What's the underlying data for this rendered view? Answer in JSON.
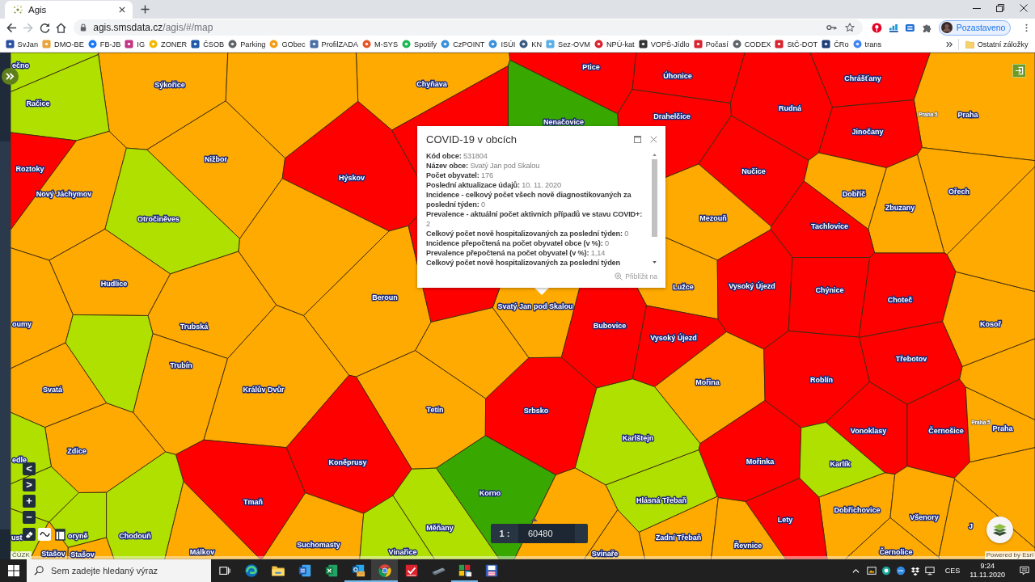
{
  "browser": {
    "tab": {
      "title": "Agis"
    },
    "nav": {
      "back_disabled": false,
      "forward_disabled": true
    },
    "address": {
      "host": "agis.smsdata.cz",
      "path": "/agis/#/map"
    },
    "profile": {
      "label": "Pozastaveno"
    },
    "bookmarks": [
      "SvJan",
      "DMO-BE",
      "FB-JB",
      "IG",
      "ZONER",
      "ČSOB",
      "Parking",
      "GObec",
      "ProfilZADA",
      "M-SYS",
      "Spotify",
      "CzPOINT",
      "ISÚI",
      "KN",
      "Sez-OVM",
      "NPÚ-kat",
      "VOPŠ-Jídlo",
      "Počasí",
      "CODEX",
      "StČ-DOT",
      "ČRo",
      "trans"
    ],
    "other_bookmarks": "Ostatní záložky"
  },
  "map": {
    "municipalities": [
      {
        "name": "ečno",
        "color": "#b0e000"
      },
      {
        "name": "Ptice",
        "color": "#ff0000"
      },
      {
        "name": "Úhonice",
        "color": "#ff0000"
      },
      {
        "name": "Chrášťany",
        "color": "#ff0000"
      },
      {
        "name": "Sýkořice",
        "color": "#ffaa00"
      },
      {
        "name": "Chyňava",
        "color": "#ffaa00"
      },
      {
        "name": "Račice",
        "color": "#b0e000"
      },
      {
        "name": "Rudná",
        "color": "#ff0000"
      },
      {
        "name": "Drahelčice",
        "color": "#ff0000"
      },
      {
        "name": "Praha",
        "color": "#ffaa00"
      },
      {
        "name": "Nenačovice",
        "color": "#38a800"
      },
      {
        "name": "Jinočany",
        "color": "#ff0000"
      },
      {
        "name": "Nižbor",
        "color": "#ffaa00"
      },
      {
        "name": "Roztoky",
        "color": "#ff0000"
      },
      {
        "name": "Nučice",
        "color": "#ff0000"
      },
      {
        "name": "Hýskov",
        "color": "#ff0000"
      },
      {
        "name": "Nový Jáchymov",
        "color": "#ffaa00"
      },
      {
        "name": "Dobříč",
        "color": "#ffaa00"
      },
      {
        "name": "Ořech",
        "color": "#ffaa00"
      },
      {
        "name": "Zbuzany",
        "color": "#ffaa00"
      },
      {
        "name": "Otročiněves",
        "color": "#b0e000"
      },
      {
        "name": "Mezouň",
        "color": "#ffaa00"
      },
      {
        "name": "Tachlovice",
        "color": "#ff0000"
      },
      {
        "name": "Hudlice",
        "color": "#ffaa00"
      },
      {
        "name": "Lužce",
        "color": "#ffaa00"
      },
      {
        "name": "Vysoký Újezd",
        "color": "#ff0000"
      },
      {
        "name": "Chýnice",
        "color": "#ff0000"
      },
      {
        "name": "Beroun",
        "color": "#ffaa00"
      },
      {
        "name": "Choteč",
        "color": "#ff0000"
      },
      {
        "name": "Svatý Jan pod Skalou",
        "color": "#ffaa00"
      },
      {
        "name": "oumy",
        "color": "#ffaa00"
      },
      {
        "name": "Trubská",
        "color": "#ffaa00"
      },
      {
        "name": "Bubovice",
        "color": "#ff0000"
      },
      {
        "name": "Kosoř",
        "color": "#ffaa00"
      },
      {
        "name": "Vysoký Újezd",
        "color": "#ff0000"
      },
      {
        "name": "Třebotov",
        "color": "#ff0000"
      },
      {
        "name": "Trubín",
        "color": "#ffaa00"
      },
      {
        "name": "Mořina",
        "color": "#ffaa00"
      },
      {
        "name": "Roblín",
        "color": "#ff0000"
      },
      {
        "name": "Svatá",
        "color": "#ffaa00"
      },
      {
        "name": "Králův Dvůr",
        "color": "#ffaa00"
      },
      {
        "name": "Tetín",
        "color": "#ffaa00"
      },
      {
        "name": "Srbsko",
        "color": "#ff0000"
      },
      {
        "name": "Vonoklasy",
        "color": "#ff0000"
      },
      {
        "name": "Černošice",
        "color": "#ff0000"
      },
      {
        "name": "Praha",
        "color": "#ffaa00"
      },
      {
        "name": "Karlštejn",
        "color": "#b0e000"
      },
      {
        "name": "Zdice",
        "color": "#ffaa00"
      },
      {
        "name": "edle",
        "color": "#b0e000"
      },
      {
        "name": "Koněprusy",
        "color": "#ff0000"
      },
      {
        "name": "Mořinka",
        "color": "#ff0000"
      },
      {
        "name": "Karlík",
        "color": "#b0e000"
      },
      {
        "name": "Korno",
        "color": "#38a800"
      },
      {
        "name": "Tmaň",
        "color": "#ff0000"
      },
      {
        "name": "Hlásná Třebaň",
        "color": "#b0e000"
      },
      {
        "name": "Dobřichovice",
        "color": "#ffaa00"
      },
      {
        "name": "Lety",
        "color": "#ff0000"
      },
      {
        "name": "Všenory",
        "color": "#ffaa00"
      },
      {
        "name": "Měňany",
        "color": "#b0e000"
      },
      {
        "name": "J",
        "color": "#ffaa00"
      },
      {
        "name": "ust",
        "color": "#b0e000"
      },
      {
        "name": "oryně",
        "color": "#b0e000"
      },
      {
        "name": "Chodouň",
        "color": "#b0e000"
      },
      {
        "name": "Zadní Třebaň",
        "color": "#ffaa00"
      },
      {
        "name": "Suchomasty",
        "color": "#ffaa00"
      },
      {
        "name": "Řevnice",
        "color": "#ffaa00"
      },
      {
        "name": "Stašov",
        "color": "#ffaa00"
      },
      {
        "name": "Stašov",
        "color": "#ffaa00"
      },
      {
        "name": "Málkov",
        "color": "#ffaa00"
      },
      {
        "name": "Vinařice",
        "color": "#b0e000"
      },
      {
        "name": "Svinaře",
        "color": "#ffaa00"
      },
      {
        "name": "Černolice",
        "color": "#ffaa00"
      }
    ],
    "unlabeled_areas": [
      {
        "color": "#ff0000"
      },
      {
        "color": "#ff0000"
      },
      {
        "color": "#b0e000"
      },
      {
        "color": "#b0e000"
      },
      {
        "color": "#ffaa00"
      },
      {
        "color": "#ffaa00"
      },
      {
        "color": "#ffaa00"
      },
      {
        "color": "#ffaa00"
      },
      {
        "color": "#ffaa00"
      },
      {
        "color": "#ffaa00"
      },
      {
        "color": "#ffaa00"
      }
    ],
    "district_labels": [
      "Praha 5",
      "Praha 5"
    ],
    "nav_buttons": [
      "<",
      ">",
      "+",
      "−"
    ],
    "scale": {
      "prefix": "1 :",
      "value": "60480"
    },
    "attribution": {
      "source": "ČÚZK",
      "powered": "Powered by Esri"
    }
  },
  "popup": {
    "title": "COVID-19 v obcích",
    "fields": [
      {
        "label": "Kód obce:",
        "value": "531804"
      },
      {
        "label": "Název obce:",
        "value": "Svatý Jan pod Skalou"
      },
      {
        "label": "Počet obyvatel:",
        "value": "176"
      },
      {
        "label": "Poslední aktualizace údajů:",
        "value": "10. 11. 2020"
      },
      {
        "label": "Incidence - celkový počet všech nově diagnostikovaných za poslední týden:",
        "value": "0"
      },
      {
        "label": "Prevalence - aktuální počet aktivních případů ve stavu COVID+:",
        "value": "2"
      },
      {
        "label": "Celkový počet nově hospitalizovaných za poslední týden:",
        "value": "0"
      },
      {
        "label": "Incidence přepočtená na počet obyvatel obce (v %):",
        "value": "0"
      },
      {
        "label": "Prevalence přepočtená na počet obyvatel (v %):",
        "value": "1,14"
      },
      {
        "label": "Celkový počet nově hospitalizovaných za poslední týden"
      }
    ],
    "zoom_link": "Přiblížit na"
  },
  "taskbar": {
    "search": {
      "placeholder": "Sem zadejte hledaný výraz"
    },
    "apps": [
      {
        "kind": "edge",
        "running": false,
        "selected": false
      },
      {
        "kind": "explorer",
        "running": false,
        "selected": false
      },
      {
        "kind": "word",
        "running": false,
        "selected": false
      },
      {
        "kind": "excel",
        "running": false,
        "selected": false
      },
      {
        "kind": "outlook",
        "running": true,
        "selected": false
      },
      {
        "kind": "chrome",
        "running": true,
        "selected": true
      },
      {
        "kind": "check",
        "running": false,
        "selected": false
      },
      {
        "kind": "scanner",
        "running": false,
        "selected": false
      },
      {
        "kind": "chart",
        "running": true,
        "selected": false
      },
      {
        "kind": "floppy",
        "running": false,
        "selected": false
      }
    ],
    "language": "CES",
    "time": "9:24",
    "date": "11.11.2020"
  }
}
